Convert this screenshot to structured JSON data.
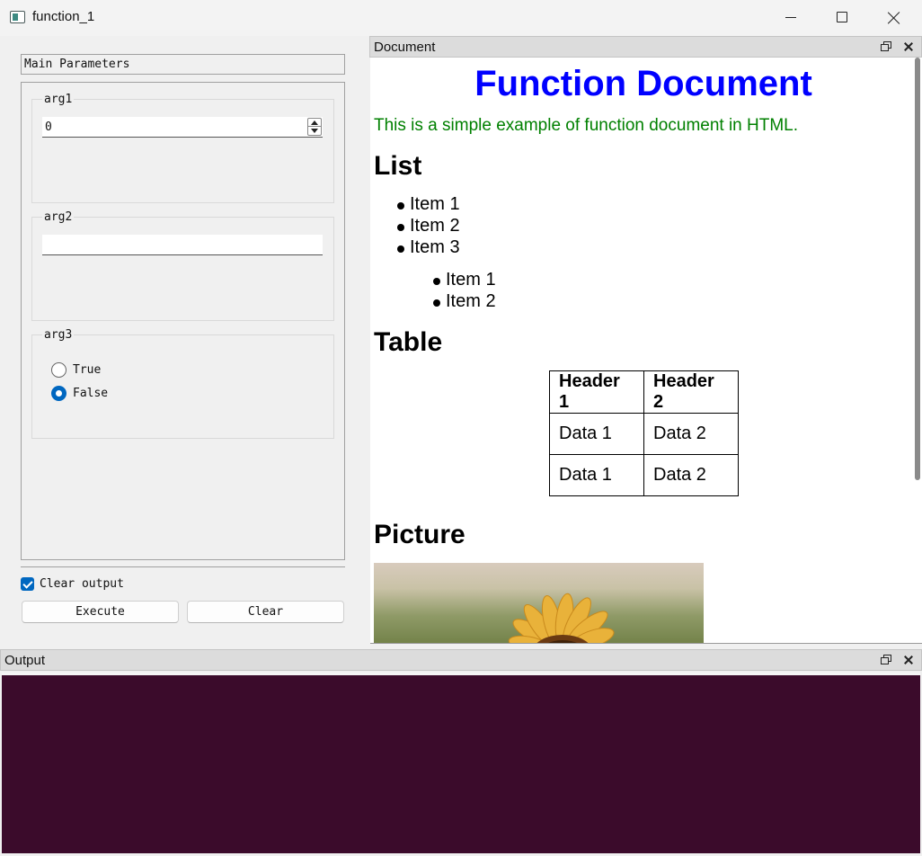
{
  "window": {
    "title": "function_1"
  },
  "left_panel": {
    "section_title": "Main Parameters",
    "arg1": {
      "title": "arg1",
      "value": "0"
    },
    "arg2": {
      "title": "arg2",
      "value": ""
    },
    "arg3": {
      "title": "arg3",
      "options": [
        {
          "label": "True",
          "checked": false
        },
        {
          "label": "False",
          "checked": true
        }
      ]
    },
    "clear_output": {
      "label": "Clear output",
      "checked": true
    },
    "buttons": {
      "execute": "Execute",
      "clear": "Clear"
    }
  },
  "document_dock": {
    "title": "Document",
    "heading": "Function Document",
    "intro": "This is a simple example of function document in HTML.",
    "list_heading": "List",
    "list_items": [
      "Item 1",
      "Item 2",
      "Item 3"
    ],
    "sub_list_items": [
      "Item 1",
      "Item 2"
    ],
    "table_heading": "Table",
    "table": {
      "headers": [
        "Header 1",
        "Header 2"
      ],
      "rows": [
        [
          "Data 1",
          "Data 2"
        ],
        [
          "Data 1",
          "Data 2"
        ]
      ]
    },
    "picture_heading": "Picture"
  },
  "output_dock": {
    "title": "Output"
  },
  "colors": {
    "heading": "#0000ff",
    "intro": "#008000",
    "accent": "#0067c0",
    "output_background": "#3b0b2b"
  },
  "icons": [
    "app-icon",
    "minimize-icon",
    "maximize-icon",
    "close-icon",
    "float-icon",
    "sunflower-image"
  ]
}
